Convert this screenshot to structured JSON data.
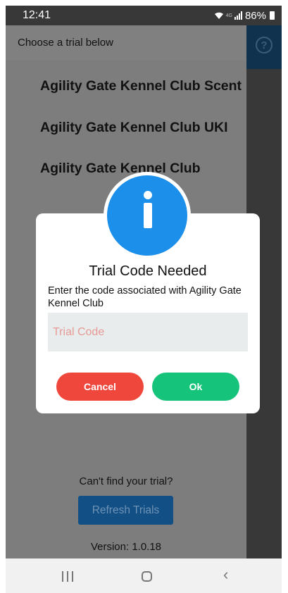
{
  "status_bar": {
    "time": "12:41",
    "network": "4G",
    "battery": "86%"
  },
  "header": {
    "title": "Choose a trial below",
    "help_icon": "?"
  },
  "trials": [
    {
      "label": "Agility Gate Kennel Club Scent"
    },
    {
      "label": "Agility Gate Kennel Club UKI"
    },
    {
      "label": "Agility Gate Kennel Club"
    }
  ],
  "footer": {
    "cant_find": "Can't find your trial?",
    "refresh_label": "Refresh Trials",
    "version": "Version: 1.0.18"
  },
  "dialog": {
    "title": "Trial Code Needed",
    "message": "Enter the code associated with Agility Gate Kennel Club",
    "input_value": "",
    "input_placeholder": "Trial Code",
    "cancel_label": "Cancel",
    "ok_label": "Ok",
    "icon": "info-icon"
  },
  "nav": {
    "back_glyph": "‹"
  },
  "colors": {
    "info_blue": "#1b8fe9",
    "cancel_red": "#f0473d",
    "ok_green": "#16c37a",
    "header_navy": "#10324f",
    "refresh_blue": "#124f84"
  }
}
